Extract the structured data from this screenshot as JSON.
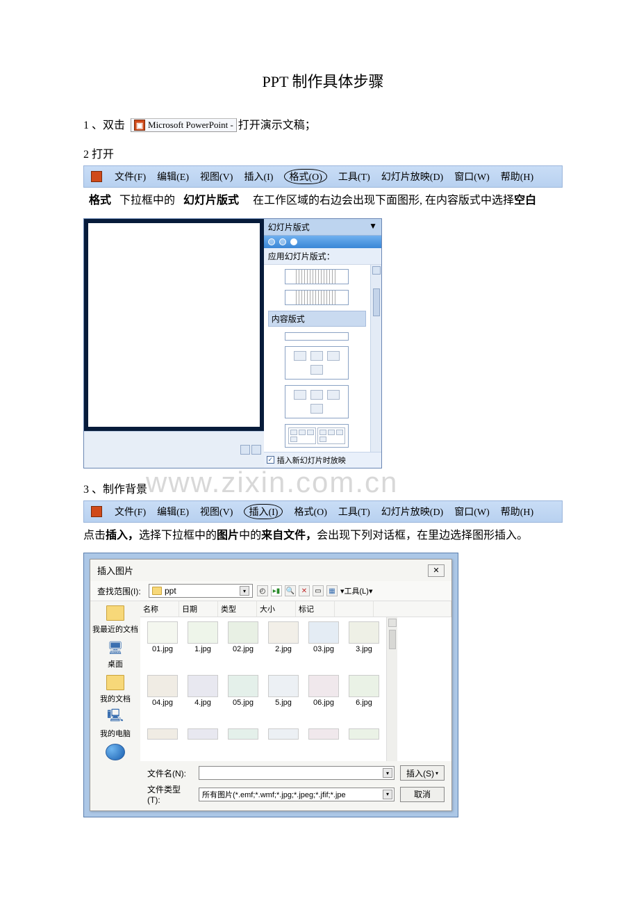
{
  "title": "PPT 制作具体步骤",
  "step1": {
    "prefix": "1 、双击",
    "icon_text": "Microsoft PowerPoint -",
    "suffix": "打开演示文稿；"
  },
  "step2": {
    "label": "2 打开"
  },
  "menubar": {
    "file": "文件(F)",
    "edit": "编辑(E)",
    "view": "视图(V)",
    "insert": "插入(I)",
    "format": "格式(O)",
    "tools": "工具(T)",
    "slideshow": "幻灯片放映(D)",
    "window": "窗口(W)",
    "help": "帮助(H)"
  },
  "exp1": {
    "p1a": "格式",
    "p1b": "下拉框中的",
    "p1c": "幻灯片版式",
    "p1d": "在工作区域的右边会出现下面图形, 在内容版式中选择",
    "p1e": "空白"
  },
  "layoutPane": {
    "title": "幻灯片版式",
    "apply": "应用幻灯片版式：",
    "content": "内容版式",
    "footer": "插入新幻灯片时放映"
  },
  "step3": {
    "label": "3 、制作背景"
  },
  "exp2": {
    "a": "点击",
    "b": "插入，",
    "c": "选择下拉框中的",
    "d": "图片",
    "e": "中的",
    "f": "来自文件，",
    "g": "会出现下列对话框，在里边选择图形插入。"
  },
  "dialog": {
    "title": "插入图片",
    "lookin": "查找范围(I):",
    "folder": "ppt",
    "tools": "▾工具(L)▾",
    "headers": {
      "name": "名称",
      "date": "日期",
      "type": "类型",
      "size": "大小",
      "tag": "标记"
    },
    "places": {
      "recent": "我最近的文档",
      "desktop": "桌面",
      "mydocs": "我的文档",
      "mycomp": "我的电脑"
    },
    "files": [
      "01.jpg",
      "1.jpg",
      "02.jpg",
      "2.jpg",
      "03.jpg",
      "3.jpg",
      "04.jpg",
      "4.jpg",
      "05.jpg",
      "5.jpg",
      "06.jpg",
      "6.jpg"
    ],
    "filename_lbl": "文件名(N):",
    "filetype_lbl": "文件类型(T):",
    "filetype_val": "所有图片(*.emf;*.wmf;*.jpg;*.jpeg;*.jfif;*.jpe",
    "insert_btn": "插入(S)",
    "cancel_btn": "取消"
  },
  "watermark": "www.zixin.com.cn"
}
